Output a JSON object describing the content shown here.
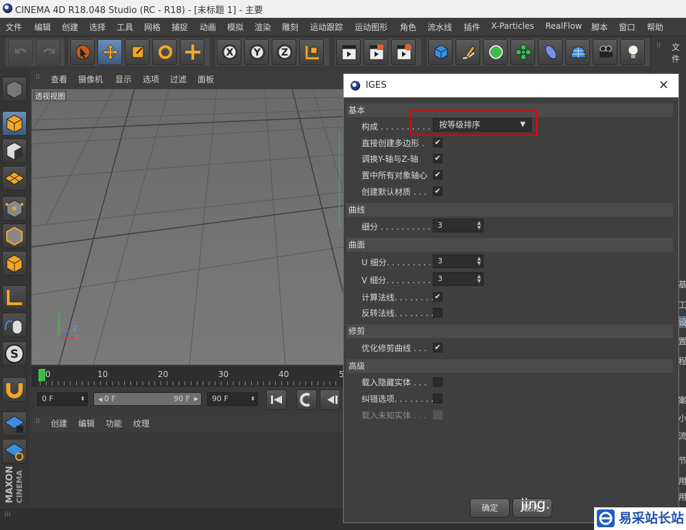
{
  "window": {
    "title": "CINEMA 4D R18.048 Studio (RC - R18) - [未标题 1] - 主要"
  },
  "menu": [
    "文件",
    "编辑",
    "创建",
    "选择",
    "工具",
    "网格",
    "捕捉",
    "动画",
    "模拟",
    "渲染",
    "雕刻",
    "运动跟踪",
    "运动图形",
    "角色",
    "流水线",
    "插件",
    "X-Particles",
    "RealFlow",
    "脚本",
    "窗口",
    "帮助"
  ],
  "viewport": {
    "menu": [
      "查看",
      "摄像机",
      "显示",
      "选项",
      "过滤",
      "面板"
    ],
    "label": "透视视图",
    "axes": {
      "y": "Y",
      "z": "Z",
      "x": "X"
    }
  },
  "timeline": {
    "ticks": [
      "0",
      "10",
      "20",
      "30",
      "40",
      "5"
    ]
  },
  "transport": {
    "start": "0 F",
    "range_start": "0 F",
    "range_end": "90 F",
    "end": "90 F"
  },
  "material_menu": [
    "创建",
    "编辑",
    "功能",
    "纹理"
  ],
  "right_panel": {
    "tab": "文件",
    "letters": [
      "基",
      "工",
      "设",
      "置",
      "程",
      "案",
      "小",
      "流",
      "节",
      "用",
      "用"
    ]
  },
  "dialog": {
    "title": "IGES",
    "sections": {
      "basic": {
        "header": "基本",
        "compose_label": "构成 . . . . . . . . . . .",
        "compose_value": "按等级排序",
        "rows": [
          {
            "label": "直接创建多边形 .",
            "checked": "✔"
          },
          {
            "label": "调换Y-轴与Z-轴",
            "checked": "✔"
          },
          {
            "label": "置中所有对象轴心",
            "checked": "✔"
          },
          {
            "label": "创建默认材质 . . .",
            "checked": "✔"
          }
        ]
      },
      "curve": {
        "header": "曲线",
        "subdiv_label": "细分 . . . . . . . . . . .",
        "subdiv_value": "3"
      },
      "surface": {
        "header": "曲面",
        "u_label": "U 细分. . . . . . . . .",
        "u_value": "3",
        "v_label": "V 细分. . . . . . . . .",
        "v_value": "3",
        "normals_label": "计算法线. . . . . . . .",
        "normals_checked": "✔",
        "reverse_label": "反转法线. . . . . . . .",
        "reverse_checked": ""
      },
      "trim": {
        "header": "修剪",
        "optimize_label": "优化修剪曲线 . . .",
        "optimize_checked": "✔"
      },
      "advanced": {
        "header": "高级",
        "hidden_label": "载入隐藏实体 . . .",
        "errors_label": "纠错选项. . . . . . . .",
        "unknown_label": "载入未知实体 . . ."
      }
    },
    "ok_label": "确定",
    "cancel_label": "取消"
  },
  "watermark": {
    "jing": "jing.",
    "site": "易采站长站"
  }
}
